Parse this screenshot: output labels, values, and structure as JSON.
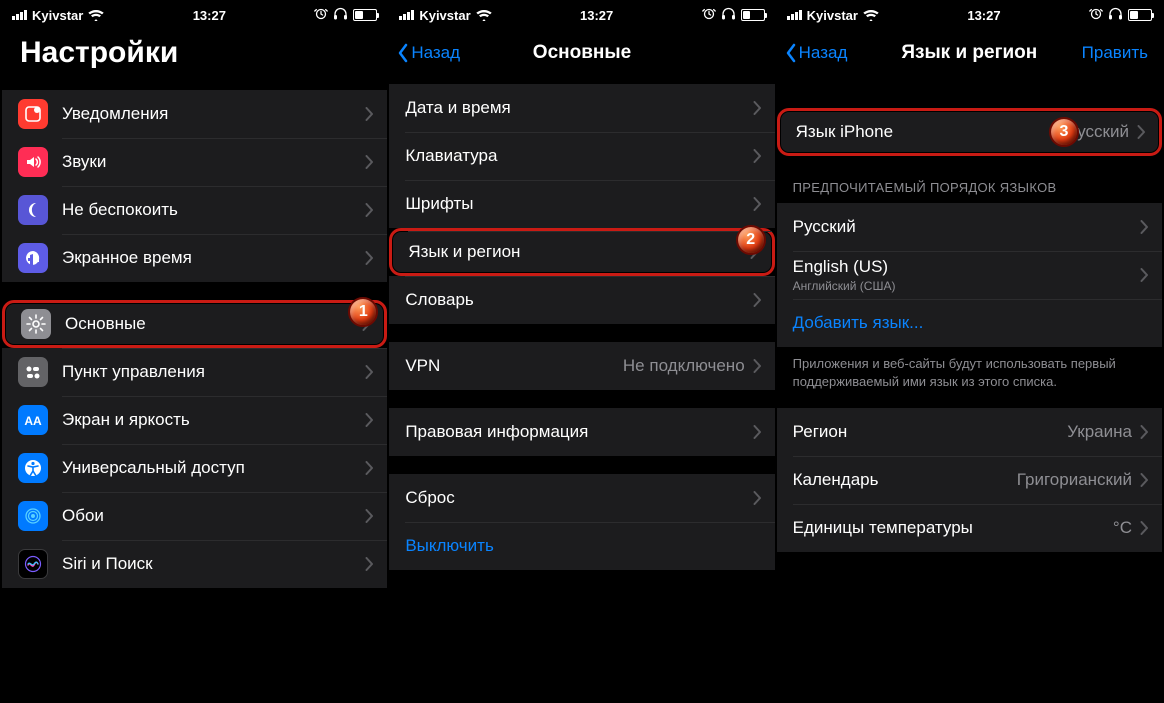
{
  "status": {
    "carrier": "Kyivstar",
    "time": "13:27"
  },
  "markers": {
    "m1": "1",
    "m2": "2",
    "m3": "3"
  },
  "s1": {
    "title": "Настройки",
    "g1": [
      {
        "label": "Уведомления",
        "icon": "notifications-icon",
        "bg": "bg-red"
      },
      {
        "label": "Звуки",
        "icon": "sounds-icon",
        "bg": "bg-pink"
      },
      {
        "label": "Не беспокоить",
        "icon": "dnd-icon",
        "bg": "bg-purple"
      },
      {
        "label": "Экранное время",
        "icon": "screentime-icon",
        "bg": "bg-indigo"
      }
    ],
    "g2": [
      {
        "label": "Основные",
        "icon": "gear-icon",
        "bg": "bg-gray"
      },
      {
        "label": "Пункт управления",
        "icon": "control-center-icon",
        "bg": "bg-lgray"
      },
      {
        "label": "Экран и яркость",
        "icon": "display-icon",
        "bg": "bg-blue"
      },
      {
        "label": "Универсальный доступ",
        "icon": "accessibility-icon",
        "bg": "bg-blue"
      },
      {
        "label": "Обои",
        "icon": "wallpaper-icon",
        "bg": "bg-blue"
      },
      {
        "label": "Siri и Поиск",
        "icon": "siri-icon",
        "bg": "bg-black"
      }
    ]
  },
  "s2": {
    "back": "Назад",
    "title": "Основные",
    "g1": [
      {
        "label": "Дата и время"
      },
      {
        "label": "Клавиатура"
      },
      {
        "label": "Шрифты"
      },
      {
        "label": "Язык и регион"
      },
      {
        "label": "Словарь"
      }
    ],
    "g2": [
      {
        "label": "VPN",
        "value": "Не подключено"
      }
    ],
    "g3": [
      {
        "label": "Правовая информация"
      }
    ],
    "g4": [
      {
        "label": "Сброс"
      },
      {
        "label": "Выключить",
        "link": true,
        "nochev": true
      }
    ]
  },
  "s3": {
    "back": "Назад",
    "title": "Язык и регион",
    "edit": "Править",
    "g1": [
      {
        "label": "Язык iPhone",
        "value": "Русский"
      }
    ],
    "g2_header": "ПРЕДПОЧИТАЕМЫЙ ПОРЯДОК ЯЗЫКОВ",
    "g2": [
      {
        "label": "Русский"
      },
      {
        "label": "English (US)",
        "sublabel": "Английский (США)"
      },
      {
        "label": "Добавить язык...",
        "link": true
      }
    ],
    "g2_footer": "Приложения и веб-сайты будут использовать первый поддерживаемый ими язык из этого списка.",
    "g3": [
      {
        "label": "Регион",
        "value": "Украина"
      },
      {
        "label": "Календарь",
        "value": "Григорианский"
      },
      {
        "label": "Единицы температуры",
        "value": "°C"
      }
    ]
  }
}
